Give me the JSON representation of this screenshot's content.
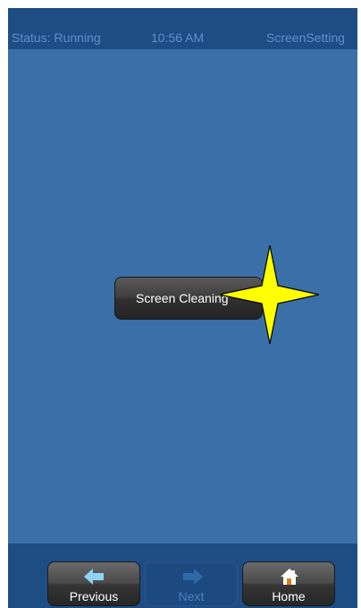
{
  "status_bar": {
    "status": "Status: Running",
    "time": "10:56 AM",
    "screen_name": "ScreenSetting"
  },
  "main": {
    "screen_cleaning_label": "Screen Cleaning"
  },
  "bottom_nav": {
    "previous": {
      "label": "Previous",
      "icon": "arrow-left-icon",
      "enabled": true
    },
    "next": {
      "label": "Next",
      "icon": "arrow-right-icon",
      "enabled": false
    },
    "home": {
      "label": "Home",
      "icon": "home-icon",
      "enabled": true
    }
  },
  "highlight_marker": {
    "icon": "star-marker-icon",
    "color": "#ffff00"
  },
  "colors": {
    "background": "#3b6fa7",
    "bars": "#1e4d84",
    "status_text": "#5f8fcb"
  }
}
